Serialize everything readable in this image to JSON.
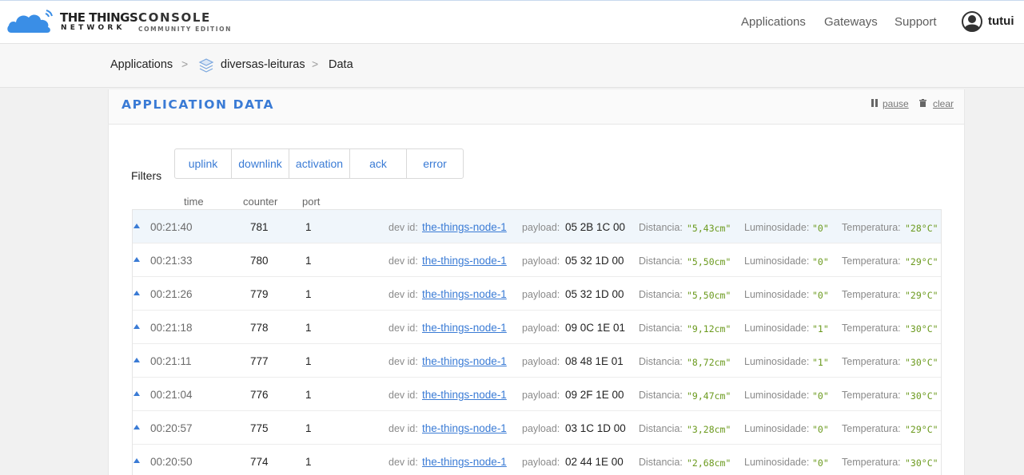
{
  "header": {
    "brand_line1": "THE THINGS",
    "brand_line2": "NETWORK",
    "console_title": "CONSOLE",
    "console_subtitle": "COMMUNITY EDITION",
    "nav": [
      "Applications",
      "Gateways",
      "Support"
    ],
    "user": "tutui"
  },
  "breadcrumb": {
    "items": [
      "Applications",
      "diversas-leituras",
      "Data"
    ],
    "separator": ">"
  },
  "panel": {
    "title": "APPLICATION DATA",
    "pause_label": "pause",
    "clear_label": "clear"
  },
  "filters": {
    "label": "Filters",
    "buttons": [
      "uplink",
      "downlink",
      "activation",
      "ack",
      "error"
    ]
  },
  "columns": [
    "time",
    "counter",
    "port"
  ],
  "field_labels": {
    "dev_id": "dev id:",
    "payload": "payload:",
    "distancia": "Distancia:",
    "luminosidade": "Luminosidade:",
    "temperatura": "Temperatura:"
  },
  "rows": [
    {
      "time": "00:21:40",
      "counter": "781",
      "port": "1",
      "dev_id": "the-things-node-1",
      "payload": "05 2B 1C 00",
      "distancia": "\"5,43cm\"",
      "luminosidade": "\"0\"",
      "temperatura": "\"28°C\""
    },
    {
      "time": "00:21:33",
      "counter": "780",
      "port": "1",
      "dev_id": "the-things-node-1",
      "payload": "05 32 1D 00",
      "distancia": "\"5,50cm\"",
      "luminosidade": "\"0\"",
      "temperatura": "\"29°C\""
    },
    {
      "time": "00:21:26",
      "counter": "779",
      "port": "1",
      "dev_id": "the-things-node-1",
      "payload": "05 32 1D 00",
      "distancia": "\"5,50cm\"",
      "luminosidade": "\"0\"",
      "temperatura": "\"29°C\""
    },
    {
      "time": "00:21:18",
      "counter": "778",
      "port": "1",
      "dev_id": "the-things-node-1",
      "payload": "09 0C 1E 01",
      "distancia": "\"9,12cm\"",
      "luminosidade": "\"1\"",
      "temperatura": "\"30°C\""
    },
    {
      "time": "00:21:11",
      "counter": "777",
      "port": "1",
      "dev_id": "the-things-node-1",
      "payload": "08 48 1E 01",
      "distancia": "\"8,72cm\"",
      "luminosidade": "\"1\"",
      "temperatura": "\"30°C\""
    },
    {
      "time": "00:21:04",
      "counter": "776",
      "port": "1",
      "dev_id": "the-things-node-1",
      "payload": "09 2F 1E 00",
      "distancia": "\"9,47cm\"",
      "luminosidade": "\"0\"",
      "temperatura": "\"30°C\""
    },
    {
      "time": "00:20:57",
      "counter": "775",
      "port": "1",
      "dev_id": "the-things-node-1",
      "payload": "03 1C 1D 00",
      "distancia": "\"3,28cm\"",
      "luminosidade": "\"0\"",
      "temperatura": "\"29°C\""
    },
    {
      "time": "00:20:50",
      "counter": "774",
      "port": "1",
      "dev_id": "the-things-node-1",
      "payload": "02 44 1E 00",
      "distancia": "\"2,68cm\"",
      "luminosidade": "\"0\"",
      "temperatura": "\"30°C\""
    }
  ],
  "colors": {
    "accent": "#3a7bd5",
    "value_green": "#6b9a1e",
    "selected_row": "#f0f6fb"
  },
  "icons": [
    "ttn-cloud-logo",
    "user-avatar-icon",
    "application-layers-icon",
    "pause-icon",
    "trash-icon",
    "uplink-arrow-icon"
  ]
}
